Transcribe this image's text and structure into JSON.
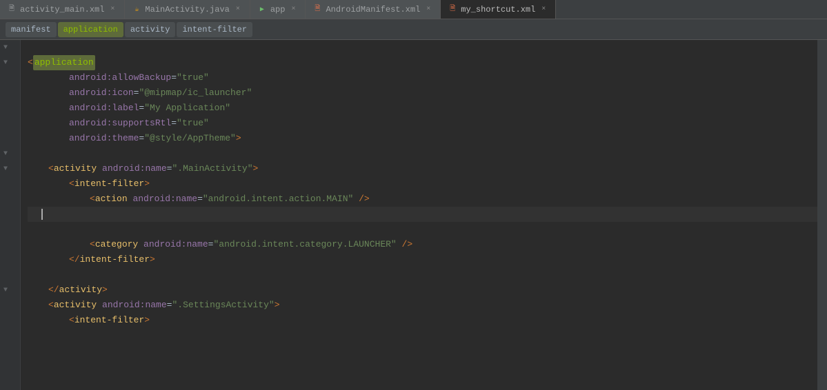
{
  "tabs": [
    {
      "id": "activity_main",
      "label": "activity_main.xml",
      "icon": "xml-icon",
      "active": false
    },
    {
      "id": "main_activity",
      "label": "MainActivity.java",
      "icon": "java-icon",
      "active": false
    },
    {
      "id": "app",
      "label": "app",
      "icon": "gradle-icon",
      "active": false
    },
    {
      "id": "android_manifest",
      "label": "AndroidManifest.xml",
      "icon": "xml-icon",
      "active": false
    },
    {
      "id": "my_shortcut",
      "label": "my_shortcut.xml",
      "icon": "xml-icon",
      "active": true
    }
  ],
  "breadcrumbs": [
    {
      "id": "manifest",
      "label": "manifest",
      "highlight": false
    },
    {
      "id": "application",
      "label": "application",
      "highlight": true
    },
    {
      "id": "activity",
      "label": "activity",
      "highlight": false
    },
    {
      "id": "intent-filter",
      "label": "intent-filter",
      "highlight": false
    }
  ],
  "lines": [
    {
      "num": "",
      "content": ""
    },
    {
      "num": "",
      "content": "application_open"
    },
    {
      "num": "",
      "content": "allow_backup"
    },
    {
      "num": "",
      "content": "icon"
    },
    {
      "num": "",
      "content": "label"
    },
    {
      "num": "",
      "content": "supports_rtl"
    },
    {
      "num": "",
      "content": "theme"
    },
    {
      "num": "",
      "content": ""
    },
    {
      "num": "",
      "content": "activity_tag"
    },
    {
      "num": "",
      "content": "intent_filter_open"
    },
    {
      "num": "",
      "content": "action"
    },
    {
      "num": "",
      "content": ""
    },
    {
      "num": "",
      "content": ""
    },
    {
      "num": "",
      "content": "category"
    },
    {
      "num": "",
      "content": "intent_filter_close"
    },
    {
      "num": "",
      "content": ""
    },
    {
      "num": "",
      "content": "activity_close"
    },
    {
      "num": "",
      "content": "activity2_open"
    },
    {
      "num": "",
      "content": "intent_filter2_open"
    }
  ],
  "colors": {
    "bg": "#2b2b2b",
    "gutter_bg": "#313335",
    "tab_active": "#2b2b2b",
    "tab_inactive": "#4e5254",
    "breadcrumb_highlight": "#5e6b3a",
    "tag_color": "#e8bf6a",
    "attr_color": "#9876aa",
    "value_color": "#6a8759",
    "bracket_color": "#cc7832"
  }
}
